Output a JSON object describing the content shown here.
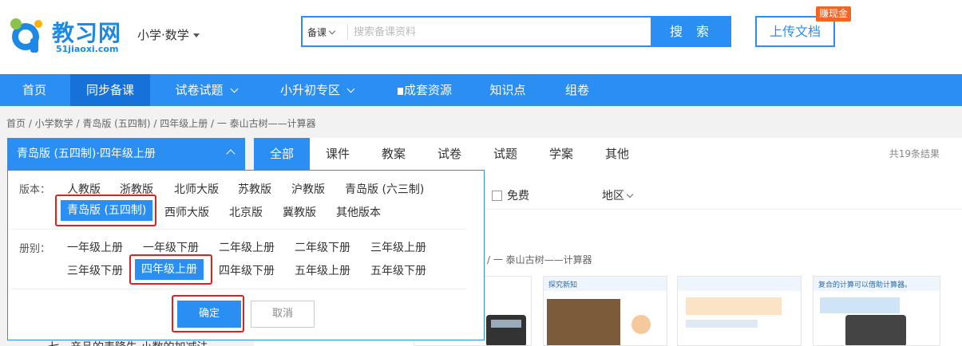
{
  "header": {
    "logo_text": "教习网",
    "logo_sub": "51jiaoxi.com",
    "subject": "小学·数学",
    "search_type": "备课",
    "search_placeholder": "搜索备课资料",
    "search_button": "搜 索",
    "upload_button": "上传文档",
    "cash_badge": "赚现金"
  },
  "nav": {
    "items": [
      {
        "label": "首页"
      },
      {
        "label": "同步备课"
      },
      {
        "label": "试卷试题"
      },
      {
        "label": "小升初专区"
      },
      {
        "label": "成套资源"
      },
      {
        "label": "知识点"
      },
      {
        "label": "组卷"
      }
    ]
  },
  "breadcrumb": "首页 /  小学数学 / 青岛版 (五四制) / 四年级上册 / 一 泰山古树——计算器",
  "edition_select": "青岛版 (五四制)·四年级上册",
  "tabs": [
    {
      "label": "全部"
    },
    {
      "label": "课件"
    },
    {
      "label": "教案"
    },
    {
      "label": "试卷"
    },
    {
      "label": "试题"
    },
    {
      "label": "学案"
    },
    {
      "label": "其他"
    }
  ],
  "result_count": "共19条结果",
  "filters": {
    "free": "免费",
    "region": "地区"
  },
  "crumb2": "/ 一 泰山古树——计算器",
  "dropdown": {
    "edition_label": "版本：",
    "editions": [
      "人教版",
      "浙教版",
      "北师大版",
      "苏教版",
      "沪教版",
      "青岛版 (六三制)",
      "青岛版 (五四制)",
      "西师大版",
      "北京版",
      "冀教版",
      "其他版本"
    ],
    "volume_label": "册别：",
    "volumes": [
      "一年级上册",
      "一年级下册",
      "二年级上册",
      "二年级下册",
      "三年级上册",
      "三年级下册",
      "四年级上册",
      "四年级下册",
      "五年级上册",
      "五年级下册"
    ],
    "ok": "确定",
    "cancel": "取消"
  },
  "thumbs": [
    {
      "title": ""
    },
    {
      "title": "探究新知"
    },
    {
      "title": ""
    },
    {
      "title": "复合的计算可以借助计算器。"
    }
  ],
  "below_text": "七、产品的表降失    小数的加减法"
}
